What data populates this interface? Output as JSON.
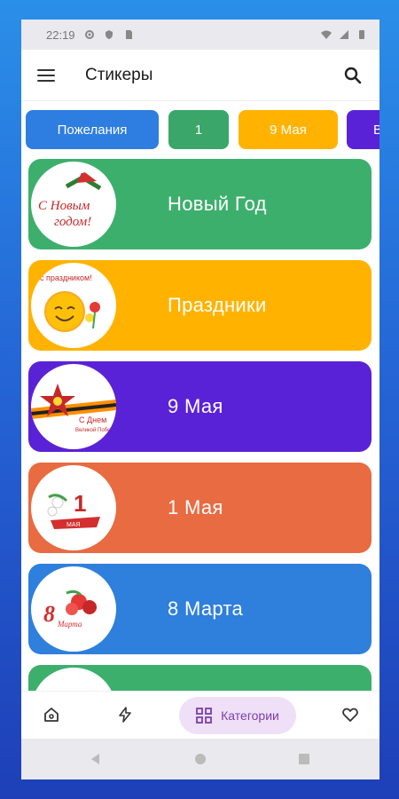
{
  "status": {
    "time": "22:19"
  },
  "appbar": {
    "title": "Стикеры"
  },
  "chips": [
    {
      "label": "Пожелания",
      "color": "#2e7de0"
    },
    {
      "label": "1",
      "color": "#3aa66a"
    },
    {
      "label": "9 Мая",
      "color": "#ffb300"
    },
    {
      "label": "В",
      "color": "#5a22d6"
    }
  ],
  "categories": [
    {
      "label": "Новый Год",
      "color": "#3daf6d",
      "thumb_text": "С Новым годом!"
    },
    {
      "label": "Праздники",
      "color": "#ffb300",
      "thumb_text": "с праздником!"
    },
    {
      "label": "9 Мая",
      "color": "#5a22d6",
      "thumb_text": "С Днем Великой Победы"
    },
    {
      "label": "1 Мая",
      "color": "#e86b42",
      "thumb_text": "1 Мая"
    },
    {
      "label": "8 Марта",
      "color": "#2f7fdc",
      "thumb_text": "8 Марта"
    },
    {
      "label": "",
      "color": "#3daf6d",
      "thumb_text": ""
    }
  ],
  "bottomnav": {
    "active_label": "Категории"
  },
  "icons": {
    "menu": "menu-icon",
    "search": "search-icon",
    "home": "home-icon",
    "lightning": "lightning-icon",
    "categories": "grid-icon",
    "favorite": "heart-icon"
  }
}
